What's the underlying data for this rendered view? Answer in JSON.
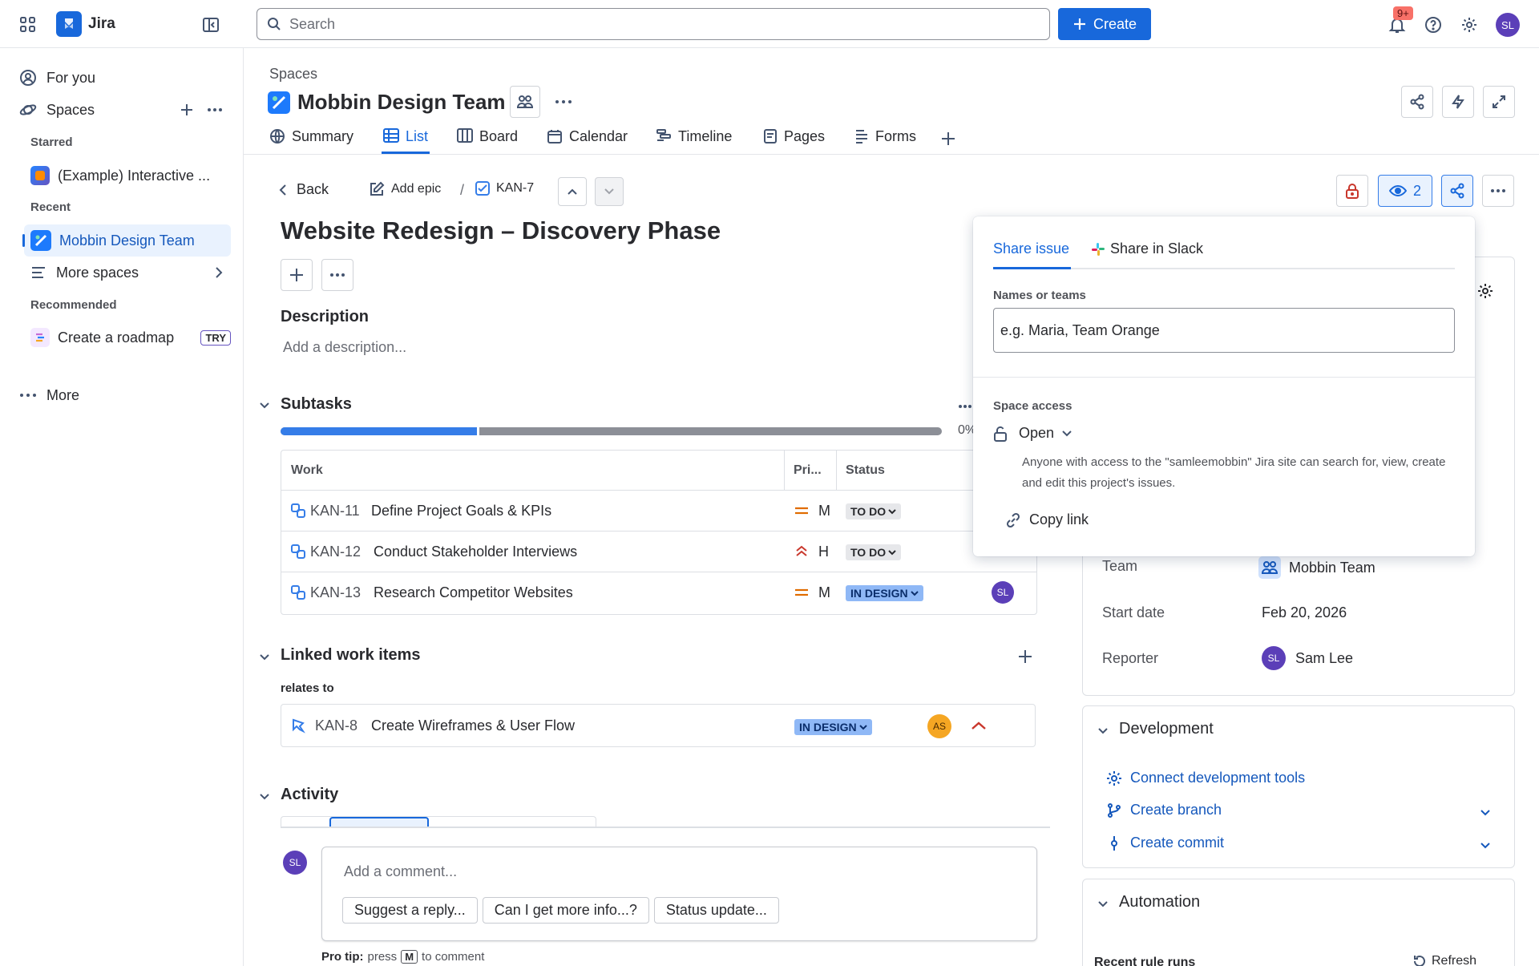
{
  "app": {
    "name": "Jira"
  },
  "topbar": {
    "search_placeholder": "Search",
    "create_label": "Create",
    "notif_badge": "9+",
    "avatar": "SL"
  },
  "sidebar": {
    "for_you": "For you",
    "spaces": "Spaces",
    "starred_heading": "Starred",
    "starred_item": "(Example) Interactive ...",
    "recent_heading": "Recent",
    "recent_item": "Mobbin Design Team",
    "more_spaces": "More spaces",
    "recommended_heading": "Recommended",
    "roadmap": "Create a roadmap",
    "try_badge": "TRY",
    "more": "More"
  },
  "space": {
    "breadcrumb": "Spaces",
    "title": "Mobbin Design Team",
    "tabs": [
      "Summary",
      "List",
      "Board",
      "Calendar",
      "Timeline",
      "Pages",
      "Forms"
    ],
    "active_tab": "List"
  },
  "issue": {
    "back": "Back",
    "add_epic": "Add epic",
    "separator": "/",
    "key": "KAN-7",
    "title": "Website Redesign – Discovery Phase",
    "watch_count": "2",
    "description_heading": "Description",
    "description_placeholder": "Add a description...",
    "subtasks_heading": "Subtasks",
    "progress_label": "0%",
    "progress_done_fraction": 0.3,
    "table_headers": {
      "work": "Work",
      "priority": "Pri...",
      "status": "Status"
    },
    "subtasks": [
      {
        "key": "KAN-11",
        "summary": "Define Project Goals & KPIs",
        "priority": "M",
        "status": "TO DO"
      },
      {
        "key": "KAN-12",
        "summary": "Conduct Stakeholder Interviews",
        "priority": "H",
        "status": "TO DO"
      },
      {
        "key": "KAN-13",
        "summary": "Research Competitor Websites",
        "priority": "M",
        "status": "IN DESIGN",
        "assignee": "SL"
      }
    ],
    "linked_heading": "Linked work items",
    "relates_to": "relates to",
    "linked": {
      "key": "KAN-8",
      "summary": "Create Wireframes & User Flow",
      "status": "IN DESIGN",
      "assignee": "AS"
    },
    "activity_heading": "Activity",
    "comment_avatar": "SL",
    "comment_placeholder": "Add a comment...",
    "suggestions": [
      "Suggest a reply...",
      "Can I get more info...?",
      "Status update..."
    ],
    "pro_tip_bold": "Pro tip:",
    "pro_tip_pre": "press",
    "pro_tip_key": "M",
    "pro_tip_post": "to comment"
  },
  "details": {
    "team_label": "Team",
    "team_value": "Mobbin Team",
    "start_label": "Start date",
    "start_value": "Feb 20, 2026",
    "reporter_label": "Reporter",
    "reporter_avatar": "SL",
    "reporter_value": "Sam Lee"
  },
  "development": {
    "heading": "Development",
    "connect": "Connect development tools",
    "branch": "Create branch",
    "commit": "Create commit"
  },
  "automation": {
    "heading": "Automation",
    "recent_runs": "Recent rule runs",
    "refresh": "Refresh"
  },
  "share_popup": {
    "tab_share": "Share issue",
    "tab_slack": "Share in Slack",
    "names_label": "Names or teams",
    "names_placeholder": "e.g. Maria, Team Orange",
    "access_label": "Space access",
    "access_value": "Open",
    "access_desc": "Anyone with access to the \"samleemobbin\" Jira site can search for, view, create and edit this project's issues.",
    "copy_link": "Copy link"
  },
  "colors": {
    "brand": "#1868DB",
    "progress_done": "#357DE8",
    "progress_rest": "#8C8F97",
    "avatar_purple": "#5B3FB8",
    "avatar_orange": "#F5A623",
    "priority_orange": "#E06C00",
    "priority_red": "#C9372C"
  }
}
